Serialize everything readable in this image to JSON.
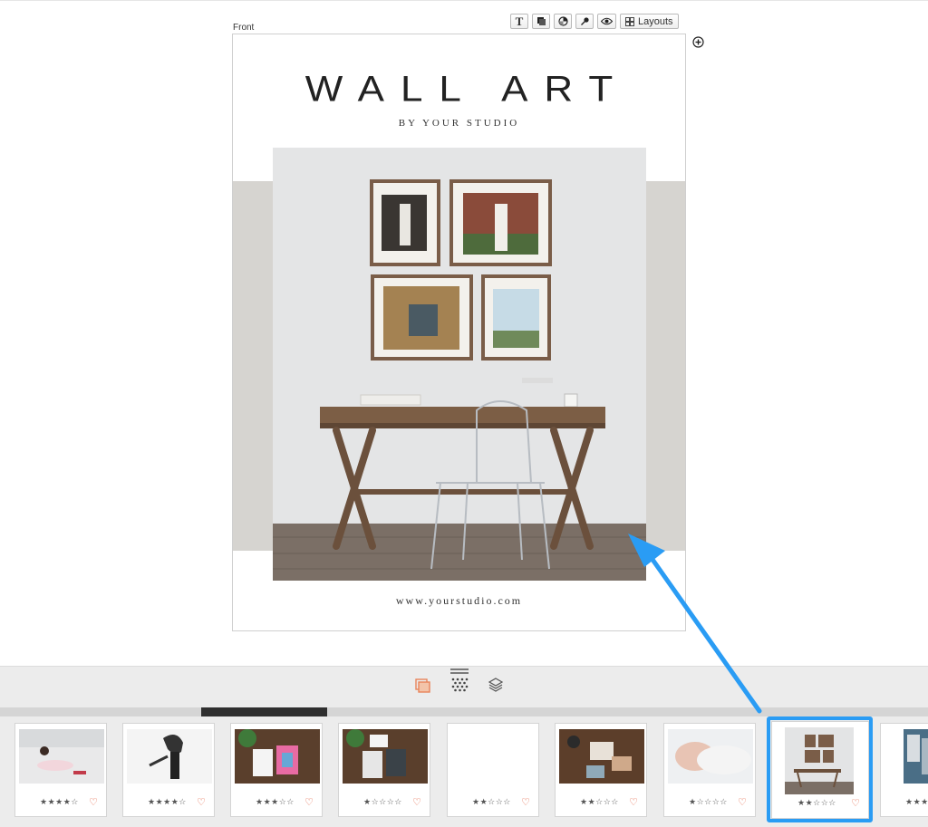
{
  "canvas": {
    "page_label": "Front",
    "title": "WALL ART",
    "subtitle": "BY YOUR STUDIO",
    "website": "www.yourstudio.com"
  },
  "toolbar": {
    "buttons": [
      {
        "name": "text-tool",
        "icon": "text-icon",
        "label": "T"
      },
      {
        "name": "layer-tool",
        "icon": "layer-icon"
      },
      {
        "name": "color-tool",
        "icon": "color-wheel-icon"
      },
      {
        "name": "dropper-tool",
        "icon": "pin-icon"
      },
      {
        "name": "preview-tool",
        "icon": "eye-icon"
      }
    ],
    "layouts_label": "Layouts"
  },
  "view_modes": [
    {
      "name": "design-view",
      "icon": "stacked-photos-icon",
      "active": true,
      "color": "#e8845a"
    },
    {
      "name": "grid-view",
      "icon": "grid-icon",
      "active": false
    },
    {
      "name": "layers-view",
      "icon": "layers-icon",
      "active": false
    }
  ],
  "filmstrip": {
    "items": [
      {
        "rating": 4,
        "favorite": false
      },
      {
        "rating": 4,
        "favorite": false
      },
      {
        "rating": 3,
        "favorite": false
      },
      {
        "rating": 1,
        "favorite": false
      },
      {
        "rating": 2,
        "favorite": false
      },
      {
        "rating": 2,
        "favorite": false
      },
      {
        "rating": 1,
        "favorite": false
      },
      {
        "rating": 2,
        "favorite": false,
        "selected": true
      },
      {
        "rating": 3,
        "favorite": false
      }
    ],
    "accent_color": "#2a9cf4"
  }
}
